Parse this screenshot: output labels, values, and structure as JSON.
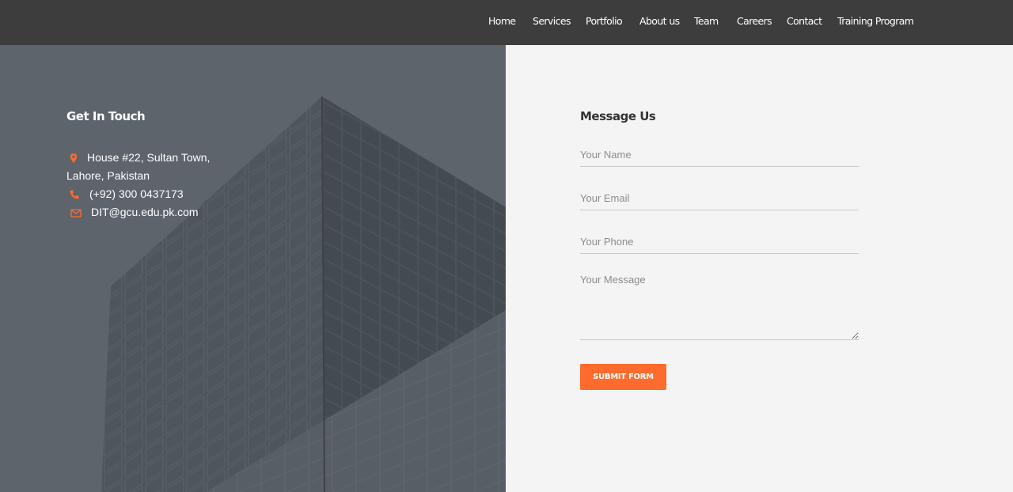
{
  "nav": {
    "items": [
      {
        "label": "Home"
      },
      {
        "label": "Services"
      },
      {
        "label": "Portfolio"
      },
      {
        "label": "About us"
      },
      {
        "label": "Team"
      },
      {
        "label": "Careers"
      },
      {
        "label": "Contact"
      },
      {
        "label": "Training Program"
      }
    ]
  },
  "contact": {
    "title": "Get In Touch",
    "address_line1": "House #22, Sultan Town,",
    "address_line2": "Lahore, Pakistan",
    "phone": "(+92) 300 0437173",
    "email": "DIT@gcu.edu.pk.com",
    "icons": [
      "location-icon",
      "phone-icon",
      "mail-icon"
    ],
    "icon_color": "#ff6b2c"
  },
  "form": {
    "title": "Message Us",
    "name_placeholder": "Your Name",
    "email_placeholder": "Your Email",
    "phone_placeholder": "Your Phone",
    "message_placeholder": "Your Message",
    "submit_label": "SUBMIT FORM"
  },
  "colors": {
    "nav_bg": "#3d3d3d",
    "accent": "#ff6b2c",
    "right_bg": "#f4f4f4"
  }
}
